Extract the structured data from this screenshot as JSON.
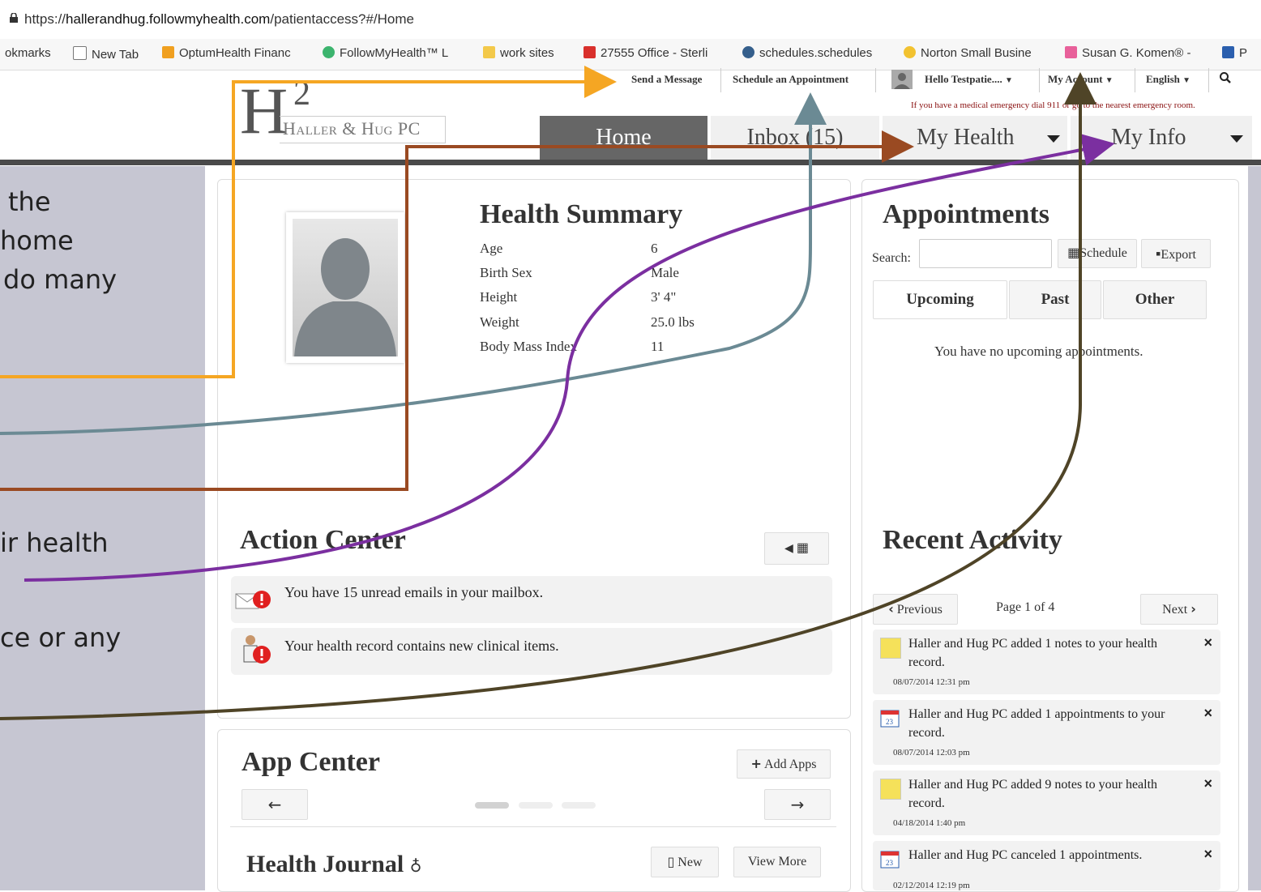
{
  "browser": {
    "url_scheme": "https://",
    "url_host": "hallerandhug.followmyhealth.com",
    "url_path": "/patientaccess?#/Home",
    "bookmarks": [
      "okmarks",
      "New Tab",
      "OptumHealth Financ",
      "FollowMyHealth™ L",
      "work sites",
      "27555 Office - Sterli",
      "schedules.schedules",
      "Norton Small Busine",
      "Susan G. Komen® -",
      "P"
    ]
  },
  "topbar": {
    "send_message": "Send a Message",
    "schedule_appt": "Schedule an Appointment",
    "hello_user": "Hello Testpatie....",
    "my_account": "My Account",
    "language": "English",
    "emergency": "If you have a medical emergency dial 911 or go to the nearest emergency room."
  },
  "logo": {
    "h": "H",
    "two": "2",
    "name": "Haller & Hug PC"
  },
  "nav": {
    "home": "Home",
    "inbox": "Inbox (15)",
    "my_health": "My Health",
    "my_info": "My Info"
  },
  "health_summary": {
    "title": "Health Summary",
    "rows": [
      {
        "label": "Age",
        "value": "6"
      },
      {
        "label": "Birth Sex",
        "value": "Male"
      },
      {
        "label": "Height",
        "value": "3' 4\""
      },
      {
        "label": "Weight",
        "value": "25.0 lbs"
      },
      {
        "label": "Body Mass Index",
        "value": "11"
      }
    ]
  },
  "appointments": {
    "title": "Appointments",
    "search_label": "Search:",
    "schedule_btn": "Schedule",
    "export_btn": "Export",
    "tabs": [
      "Upcoming",
      "Past",
      "Other"
    ],
    "empty": "You have no upcoming appointments."
  },
  "action_center": {
    "title": "Action Center",
    "messages": [
      "You have 15 unread emails in your mailbox.",
      "Your health record contains new clinical items."
    ]
  },
  "recent_activity": {
    "title": "Recent Activity",
    "previous": "Previous",
    "page": "Page 1 of 4",
    "next": "Next",
    "items": [
      {
        "text": "Haller and Hug PC added 1 notes to your health record.",
        "date": "08/07/2014 12:31 pm",
        "icon": "note-icon"
      },
      {
        "text": "Haller and Hug PC added 1 appointments to your record.",
        "date": "08/07/2014 12:03 pm",
        "icon": "calendar-icon"
      },
      {
        "text": "Haller and Hug PC added 9 notes to your health record.",
        "date": "04/18/2014 1:40 pm",
        "icon": "note-icon"
      },
      {
        "text": "Haller and Hug PC canceled 1 appointments.",
        "date": "02/12/2014 12:19 pm",
        "icon": "calendar-icon"
      }
    ]
  },
  "app_center": {
    "title": "App Center",
    "add_apps": "Add Apps"
  },
  "health_journal": {
    "title": "Health Journal",
    "new_btn": "New",
    "view_more": "View More"
  },
  "annotations": [
    "the",
    "home",
    "do many",
    "ir health",
    "ce or any"
  ],
  "colors": {
    "orange": "#f5a623",
    "gray_blue": "#6b8a94",
    "brown": "#9a4a22",
    "purple": "#7b2fa0",
    "dark_olive": "#4f4427"
  }
}
